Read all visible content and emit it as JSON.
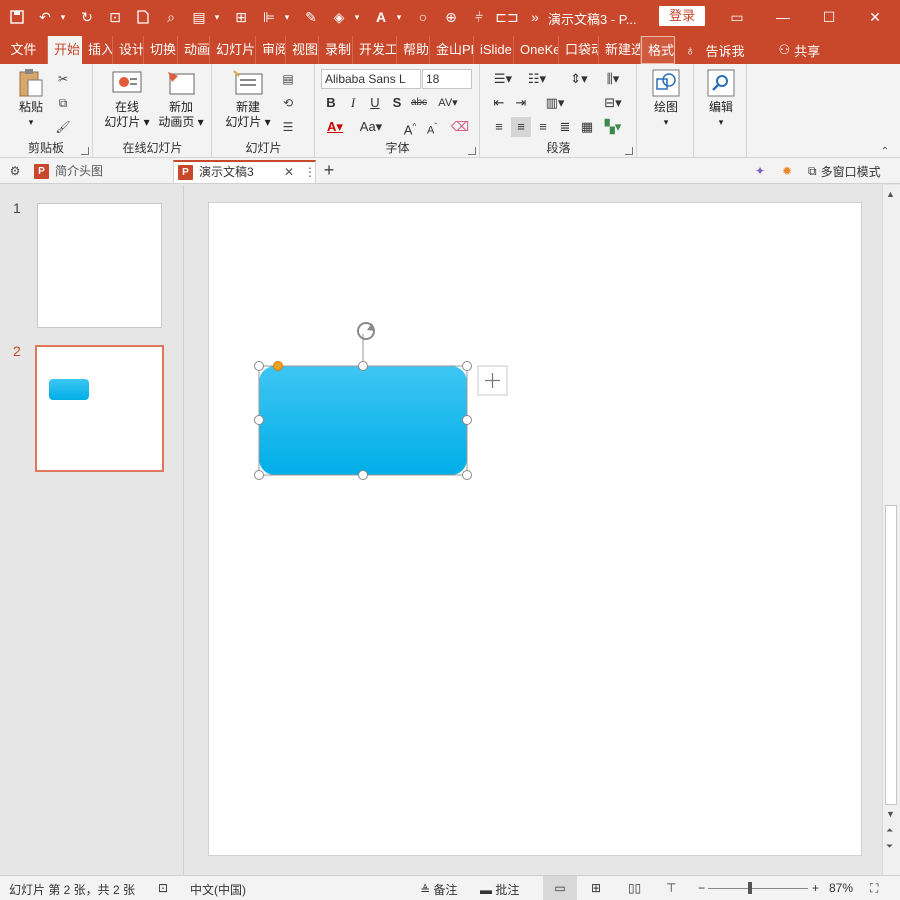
{
  "titlebar": {
    "doc_title": "演示文稿3 - P...",
    "login_label": "登录"
  },
  "tabs": [
    {
      "label": "文件"
    },
    {
      "label": "开始"
    },
    {
      "label": "插入"
    },
    {
      "label": "设计"
    },
    {
      "label": "切换"
    },
    {
      "label": "动画"
    },
    {
      "label": "幻灯片"
    },
    {
      "label": "审阅"
    },
    {
      "label": "视图"
    },
    {
      "label": "录制"
    },
    {
      "label": "开发工"
    },
    {
      "label": "帮助"
    },
    {
      "label": "金山PDF"
    },
    {
      "label": "iSlide"
    },
    {
      "label": "OneKe"
    },
    {
      "label": "口袋动"
    },
    {
      "label": "新建选"
    },
    {
      "label": "格式"
    }
  ],
  "tell_me": "告诉我",
  "share": "共享",
  "ribbon": {
    "clipboard": {
      "label": "剪贴板",
      "paste": "粘贴"
    },
    "online": {
      "label": "在线幻灯片",
      "btn1_l1": "在线",
      "btn1_l2": "幻灯片",
      "btn2_l1": "新加",
      "btn2_l2": "动画页"
    },
    "slides": {
      "label": "幻灯片",
      "new_l1": "新建",
      "new_l2": "幻灯片"
    },
    "font": {
      "label": "字体",
      "name": "Alibaba Sans L",
      "size": "18"
    },
    "paragraph": {
      "label": "段落"
    },
    "draw": {
      "label": "绘图"
    },
    "edit": {
      "label": "编辑"
    }
  },
  "doc_tabs": [
    {
      "label": "简介头图"
    },
    {
      "label": "演示文稿3"
    }
  ],
  "multi_window": "多窗口模式",
  "slides": [
    {
      "num": "1"
    },
    {
      "num": "2"
    }
  ],
  "status": {
    "slide_info": "幻灯片 第 2 张，共 2 张",
    "language": "中文(中国)",
    "notes": "备注",
    "comments": "批注",
    "zoom": "87%"
  },
  "colors": {
    "accent": "#c9472a",
    "shape_fill_top": "#3ec6f3",
    "shape_fill_bottom": "#00aee8",
    "selection_border": "#e2765a"
  }
}
